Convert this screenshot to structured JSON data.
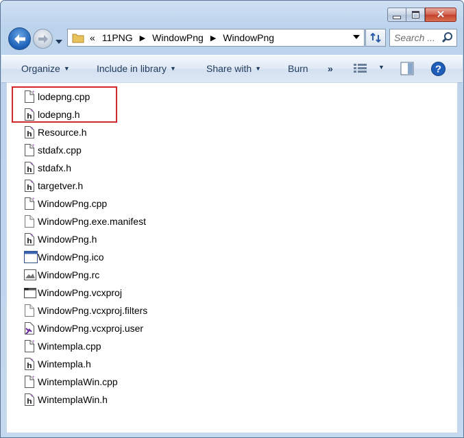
{
  "address": {
    "overflow": "«",
    "crumbs": [
      "11PNG",
      "WindowPng",
      "WindowPng"
    ]
  },
  "search": {
    "placeholder": "Search ..."
  },
  "toolbar": {
    "organize": "Organize",
    "include_in_library": "Include in library",
    "share_with": "Share with",
    "burn": "Burn",
    "more": "»"
  },
  "files": [
    {
      "name": "lodepng.cpp",
      "icon": "cpp-file-icon"
    },
    {
      "name": "lodepng.h",
      "icon": "h-file-icon"
    },
    {
      "name": "Resource.h",
      "icon": "h-file-icon"
    },
    {
      "name": "stdafx.cpp",
      "icon": "cpp-file-icon"
    },
    {
      "name": "stdafx.h",
      "icon": "h-file-icon"
    },
    {
      "name": "targetver.h",
      "icon": "h-file-icon"
    },
    {
      "name": "WindowPng.cpp",
      "icon": "cpp-file-icon"
    },
    {
      "name": "WindowPng.exe.manifest",
      "icon": "blank-file-icon"
    },
    {
      "name": "WindowPng.h",
      "icon": "h-file-icon"
    },
    {
      "name": "WindowPng.ico",
      "icon": "ico-file-icon"
    },
    {
      "name": "WindowPng.rc",
      "icon": "rc-file-icon"
    },
    {
      "name": "WindowPng.vcxproj",
      "icon": "vcxproj-file-icon"
    },
    {
      "name": "WindowPng.vcxproj.filters",
      "icon": "blank-file-icon"
    },
    {
      "name": "WindowPng.vcxproj.user",
      "icon": "vs-user-file-icon"
    },
    {
      "name": "Wintempla.cpp",
      "icon": "cpp-file-icon"
    },
    {
      "name": "Wintempla.h",
      "icon": "h-file-icon"
    },
    {
      "name": "WintemplaWin.cpp",
      "icon": "cpp-file-icon"
    },
    {
      "name": "WintemplaWin.h",
      "icon": "h-file-icon"
    }
  ],
  "colors": {
    "highlight": "#d62728",
    "toolbar_text": "#1e395b"
  }
}
